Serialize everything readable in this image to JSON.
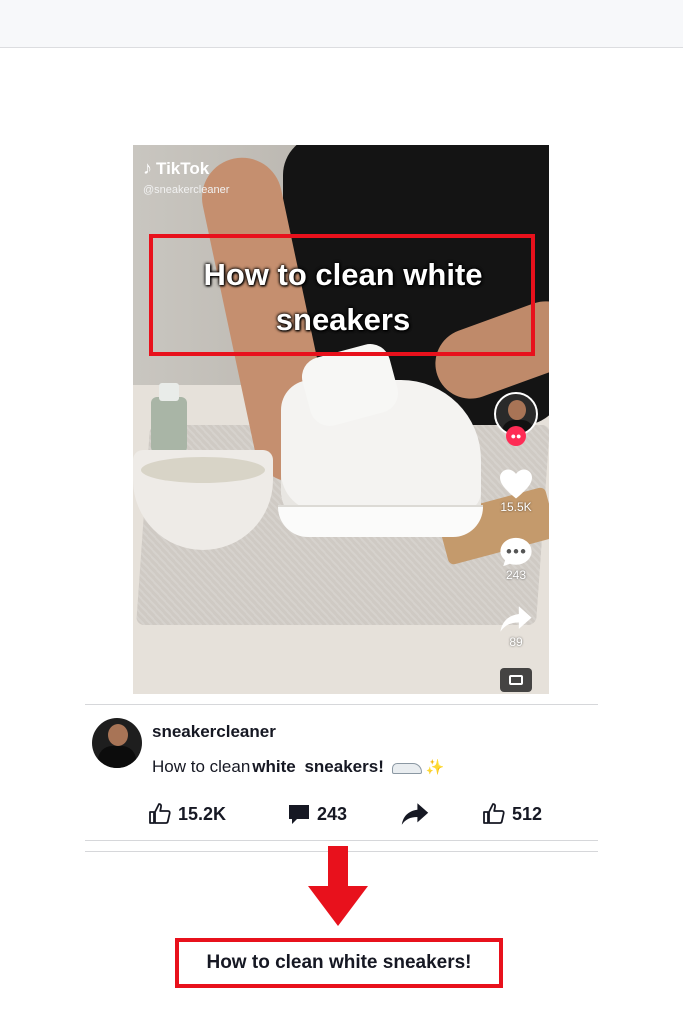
{
  "video": {
    "brand": "TikTok",
    "handle": "@sneakercleaner",
    "caption": "How to clean white sneakers",
    "side_likes": "15.5K",
    "side_comments": "243",
    "side_shares": "89"
  },
  "post": {
    "username": "sneakercleaner",
    "desc_part1": "How to clean ",
    "desc_part2": "white",
    "desc_part3": " ",
    "desc_part4": "sneakers!",
    "likes": "15.2K",
    "comments": "243",
    "extra": "512"
  },
  "result": {
    "title": "How to clean white sneakers!"
  },
  "colors": {
    "highlight": "#e8111c",
    "tiktok_pink": "#fe2c55"
  }
}
